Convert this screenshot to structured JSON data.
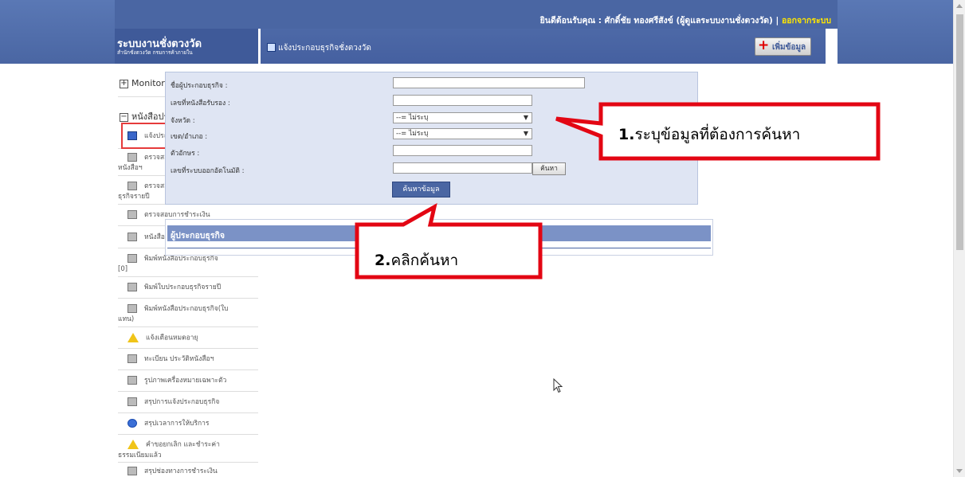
{
  "topbar": {
    "welcome": "ยินดีต้อนรับคุณ : ศักดิ์ชัย ทองศรีสังข์ (ผู้ดูแลระบบงานชั่งตวงวัด) |",
    "logout": "ออกจากระบบ"
  },
  "brand": {
    "title": "ระบบงานชั่งตวงวัด",
    "subtitle": "สำนักชั่งตวงวัด กรมการค้าภายใน"
  },
  "header": {
    "title": "แจ้งประกอบธุรกิจชั่งตวงวัด",
    "add_button": "เพิ่มข้อมูล"
  },
  "sidebar": {
    "groups": [
      {
        "label": "Monitor",
        "toggle": "+"
      },
      {
        "label": "หนังสือประกอบธุรกิจ",
        "toggle": "−"
      }
    ],
    "items": [
      {
        "label": "แจ้งประกอบธุรกิจ",
        "icon": "save-icon"
      },
      {
        "label": "ตรวจสอบการชำระเงินก่อนพิมพ์",
        "label2": "หนังสือฯ",
        "icon": "printer-icon"
      },
      {
        "label": "ตรวจสอบการชำระเงินประกอบ",
        "label2": "ธุรกิจรายปี",
        "icon": "printer-icon"
      },
      {
        "label": "ตรวจสอบการชำระเงิน",
        "icon": "printer-icon"
      },
      {
        "label": "หนังสือ ๆ ที่อยู่ระหว่างดำเนินการ",
        "icon": "edit-icon"
      },
      {
        "label": "พิมพ์หนังสือประกอบธุรกิจ",
        "label2": "[0]",
        "icon": "printer-icon"
      },
      {
        "label": "พิมพ์ใบประกอบธุรกิจรายปี",
        "icon": "printer-icon"
      },
      {
        "label": "พิมพ์หนังสือประกอบธุรกิจ(ใบ",
        "label2": "แทน)",
        "icon": "printer-icon"
      },
      {
        "label": "แจ้งเตือนหมดอายุ",
        "icon": "warning-icon"
      },
      {
        "label": "ทะเบียน ประวัติหนังสือฯ",
        "icon": "list-icon"
      },
      {
        "label": "รูปภาพเครื่องหมายเฉพาะตัว",
        "icon": "image-icon"
      },
      {
        "label": "สรุปการแจ้งประกอบธุรกิจ",
        "icon": "document-icon"
      },
      {
        "label": "สรุปเวลาการให้บริการ",
        "icon": "info-icon"
      },
      {
        "label": "คำขอยกเลิก และชำระค่า",
        "label2": "ธรรมเนียมแล้ว",
        "icon": "warning-icon"
      },
      {
        "label": "สรุปช่องทางการชำระเงิน",
        "icon": "document-icon"
      }
    ]
  },
  "form": {
    "business_name_label": "ชื่อผู้ประกอบธุรกิจ :",
    "business_name_value": "",
    "cert_no_label": "เลขที่หนังสือรับรอง :",
    "cert_no_value": "",
    "province_label": "จังหวัด :",
    "province_value": "--= ไม่ระบุ",
    "district_label": "เขต/อำเภอ :",
    "district_value": "--= ไม่ระบุ",
    "letter_label": "ตัวอักษร :",
    "letter_value": "",
    "auto_no_label": "เลขที่ระบบออกอัตโนมัติ :",
    "auto_no_value": "",
    "find_button": "ค้นหา",
    "search_button": "ค้นหาข้อมูล"
  },
  "results": {
    "title": "ผู้ประกอบธุรกิจ"
  },
  "annotations": {
    "step1_num": "1.",
    "step1_text": "ระบุข้อมูลที่ต้องการค้นหา",
    "step2_num": "2.",
    "step2_text": "คลิกค้นหา",
    "color": "#e30613"
  }
}
